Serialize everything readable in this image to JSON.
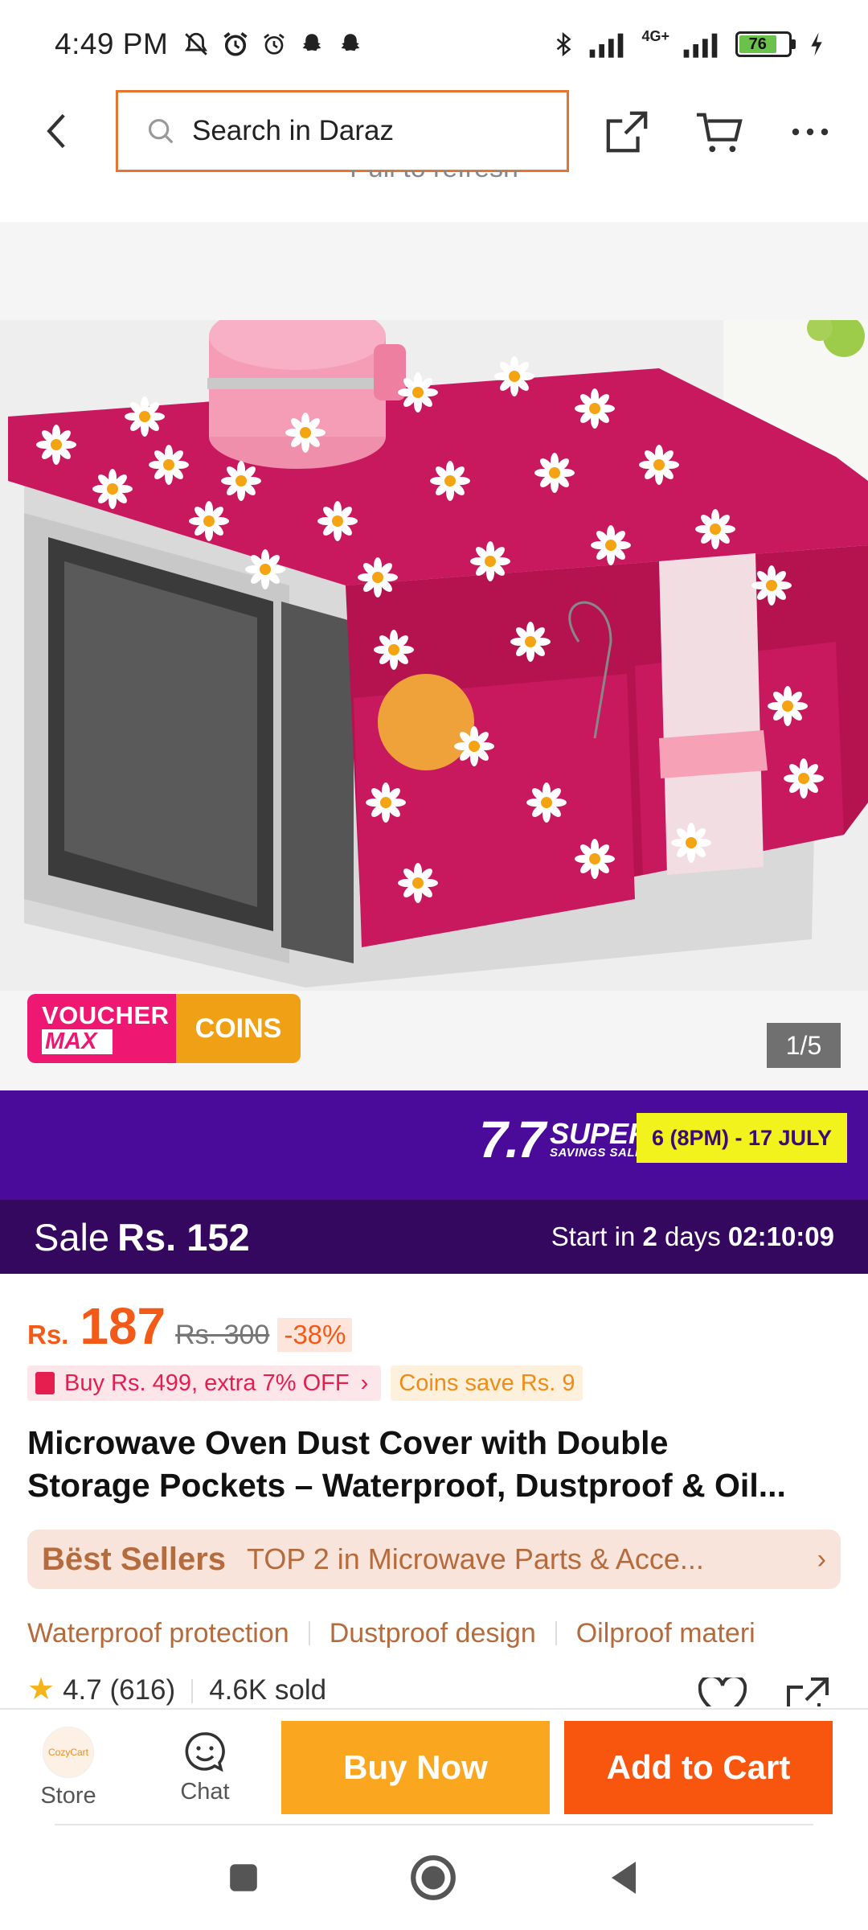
{
  "status_bar": {
    "time": "4:49 PM",
    "network": "4G+",
    "battery": "76",
    "left_icons": [
      "mute-bell-icon",
      "alarm-icon",
      "alarm-icon",
      "snapchat-icon",
      "snapchat-icon"
    ],
    "right_icons": [
      "bluetooth-icon",
      "signal-icon",
      "signal-icon",
      "battery-icon",
      "charging-icon"
    ]
  },
  "header": {
    "search_placeholder": "Search in Daraz",
    "accent_color": "#e4742f"
  },
  "pull_to_refresh": "Pull to refresh",
  "gallery": {
    "counter": "1/5",
    "voucher_line1": "VOUCHER",
    "voucher_line2": "MAX",
    "coins_label": "COINS"
  },
  "campaign": {
    "logo_number": "7.7",
    "logo_word": "SUPER",
    "logo_sub": "SAVINGS SALE",
    "date_range": "6 (8PM) - 17 JULY",
    "sale_label": "Sale",
    "sale_price": "Rs. 152",
    "start_prefix": "Start in",
    "start_days_num": "2",
    "start_days_word": "days",
    "countdown": "02:10:09",
    "banner_color": "#4a0a9a"
  },
  "price": {
    "currency": "Rs.",
    "current": "187",
    "original": "Rs. 300",
    "discount": "-38%",
    "color": "#f35a18"
  },
  "promos": {
    "bundle": "Buy Rs. 499, extra 7% OFF",
    "coins": "Coins save Rs. 9"
  },
  "product": {
    "title_line1": "Microwave Oven Dust Cover with Double",
    "title_line2": "Storage Pockets – Waterproof, Dustproof & Oil..."
  },
  "best_sellers": {
    "label": "Bëst Sellers",
    "text": "TOP 2 in Microwave Parts & Acce..."
  },
  "features": [
    "Waterproof protection",
    "Dustproof design",
    "Oilproof materi"
  ],
  "rating": {
    "score": "4.7",
    "count": "(616)",
    "sold": "4.6K sold"
  },
  "actions": {
    "store": "Store",
    "chat": "Chat",
    "buy_now": "Buy Now",
    "add_to_cart": "Add to Cart",
    "store_logo_text": "CozyCart"
  }
}
